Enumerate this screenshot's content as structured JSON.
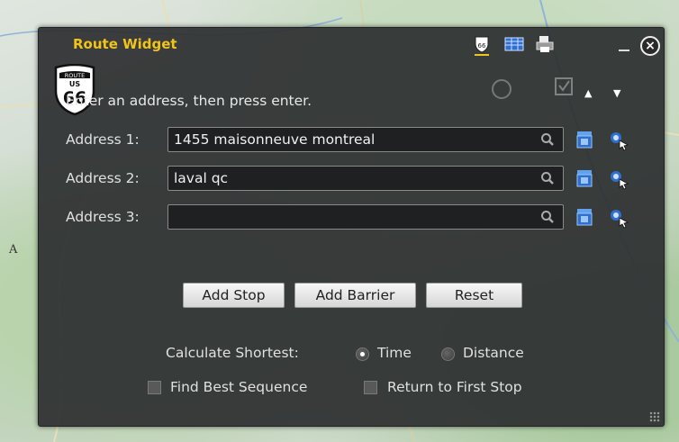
{
  "map": {
    "edge_letter": "A"
  },
  "widget": {
    "title": "Route Widget",
    "instruction": "Enter an address, then press enter.",
    "addresses": [
      {
        "label": "Address 1:",
        "value": "1455 maisonneuve montreal",
        "placeholder": ""
      },
      {
        "label": "Address 2:",
        "value": "laval qc",
        "placeholder": ""
      },
      {
        "label": "Address 3:",
        "value": "",
        "placeholder": ""
      }
    ],
    "buttons": {
      "add_stop": "Add Stop",
      "add_barrier": "Add Barrier",
      "reset": "Reset"
    },
    "calculate": {
      "label": "Calculate Shortest:",
      "options": [
        "Time",
        "Distance"
      ],
      "selected": "Time"
    },
    "checkboxes": {
      "best_sequence": "Find Best Sequence",
      "return_first": "Return to First Stop"
    },
    "logo_text": {
      "top": "ROUTE",
      "middle": "US",
      "number": "66"
    },
    "colors": {
      "title": "#f0c419",
      "panel": "#2d2f30",
      "accent_blue": "#3b7dd8"
    },
    "icons": [
      "route-shield-icon",
      "table-icon",
      "printer-icon",
      "minimize-icon",
      "close-icon",
      "search-icon",
      "pick-location-icon",
      "cursor-icon"
    ]
  }
}
